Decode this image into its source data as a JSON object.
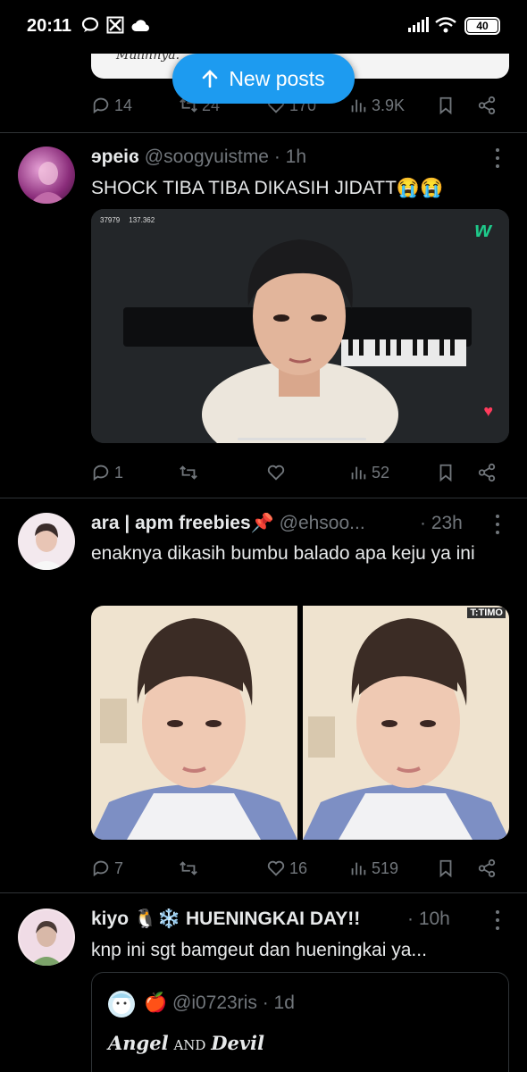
{
  "status_bar": {
    "time": "20:11",
    "battery": "40"
  },
  "new_posts": {
    "label": "New posts"
  },
  "prev_post": {
    "card_text": "Mulihnya.",
    "replies": "14",
    "reposts": "24",
    "likes": "170",
    "views": "3.9K"
  },
  "posts": [
    {
      "display_name": "ɘpeiɞ",
      "handle": "@soogyuistme",
      "time": "· 1h",
      "text": "SHOCK TIBA TIBA DIKASIH JIDATT😭😭",
      "video_views": "37979",
      "video_likes": "137.362",
      "replies": "1",
      "reposts": "",
      "likes": "",
      "views": "52"
    },
    {
      "display_name": "ara | apm freebies📌",
      "handle": "@ehsoo...",
      "time": "· 23h",
      "text": "enaknya dikasih bumbu balado apa keju ya ini",
      "watermark": "T:TIMO",
      "replies": "7",
      "reposts": "",
      "likes": "16",
      "views": "519"
    },
    {
      "display_name": "kiyo 🐧❄️ HUENINGKAI DAY!!",
      "handle": "",
      "time": "· 10h",
      "text": "knp ini sgt bamgeut dan hueningkai ya...",
      "quote": {
        "emoji": "🍎",
        "handle": "@i0723ris",
        "time": "· 1d",
        "text_a": "Angel",
        "text_and": "AND",
        "text_b": "Devil"
      }
    }
  ],
  "colors": {
    "background": "#000000",
    "accent": "#1d9bf0",
    "muted": "#71767b",
    "divider": "#2f3336",
    "text": "#e7e9ea"
  }
}
